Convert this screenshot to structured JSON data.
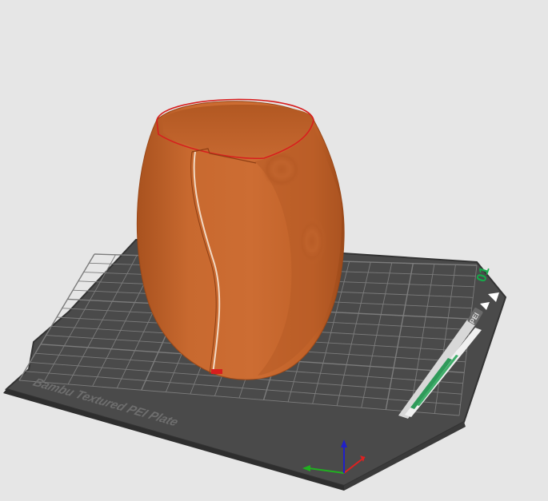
{
  "scene": {
    "plate_label": "Bambu Textured PEI Plate",
    "plate_number": "01",
    "plate_badge": "PEI",
    "plate_color": "#4a4a4a",
    "grid_color": "#7c7c7c",
    "model_color": "#c8692f",
    "seam_color": "#d71e1e",
    "axes": {
      "x_color": "#e02020",
      "y_color": "#20b020",
      "z_color": "#2020c8"
    }
  }
}
